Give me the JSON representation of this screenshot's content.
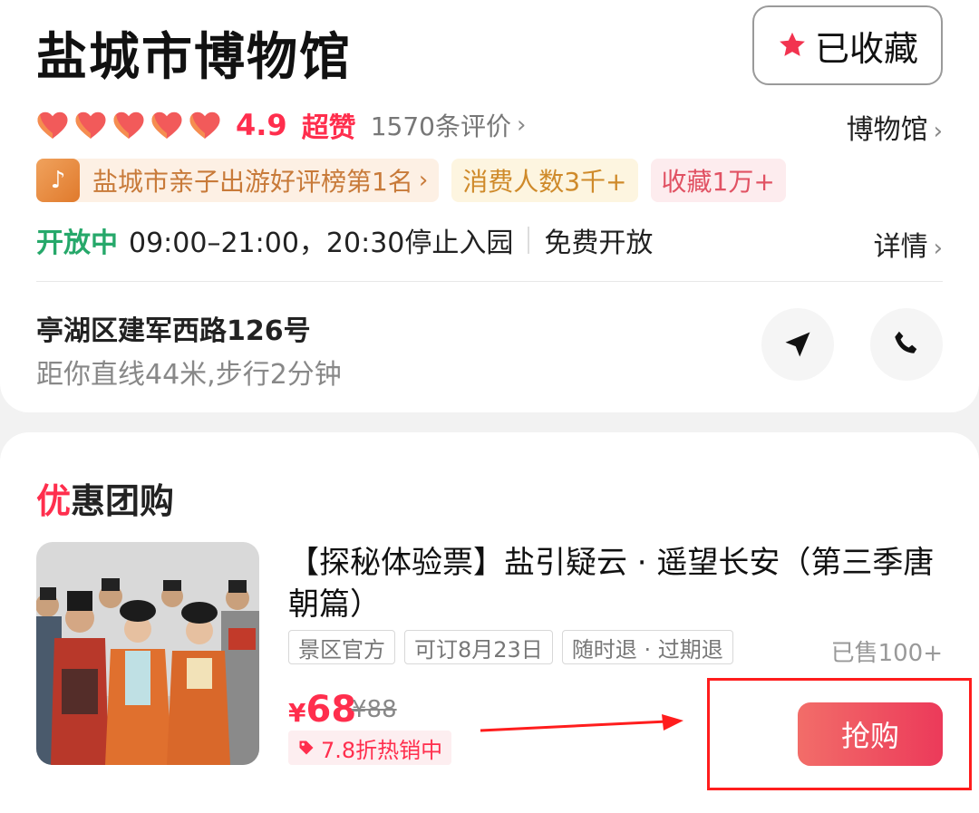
{
  "header": {
    "title": "盐城市博物馆",
    "favorite_label": "已收藏",
    "favorite_icon": "star-icon"
  },
  "rating": {
    "hearts": 5,
    "score": "4.9",
    "praise": "超赞",
    "reviews": "1570条评价",
    "category": "博物馆"
  },
  "tags": {
    "rank": "盐城市亲子出游好评榜第1名",
    "count": "消费人数3千+",
    "favorites": "收藏1万+"
  },
  "hours": {
    "status": "开放中",
    "time": "09:00–21:00，20:30停止入园",
    "fee": "免费开放",
    "details": "详情"
  },
  "location": {
    "address": "亭湖区建军西路126号",
    "distance": "距你直线44米,步行2分钟",
    "navigate_icon": "navigate-icon",
    "phone_icon": "phone-icon"
  },
  "deals": {
    "section_accent": "优",
    "section_rest": "惠团购",
    "product": {
      "title": "【探秘体验票】盐引疑云 · 遥望长安（第三季唐朝篇）",
      "features": [
        "景区官方",
        "可订8月23日",
        "随时退 · 过期退"
      ],
      "sold": "已售100+",
      "currency": "¥",
      "price": "68",
      "original_price": "¥88",
      "discount": "7.8折热销中",
      "buy_label": "抢购"
    }
  },
  "colors": {
    "accent": "#ff2e4d",
    "open_green": "#26a86a",
    "annotation_red": "#ff1d1d"
  }
}
